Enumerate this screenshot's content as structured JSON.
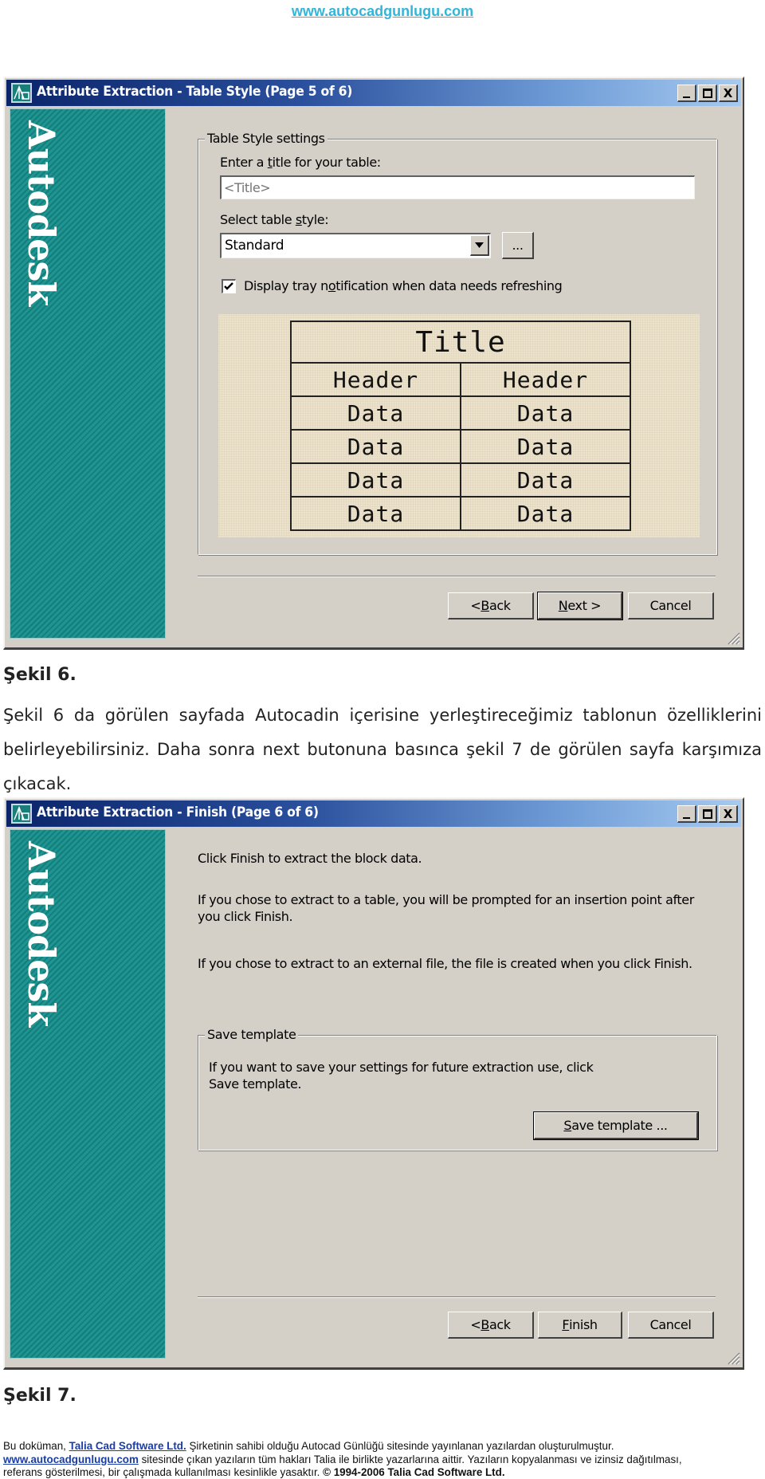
{
  "header": {
    "site_link": "www.autocadgunlugu.com"
  },
  "dialog1": {
    "title": "Attribute Extraction - Table Style (Page 5 of 6)",
    "brand": "Autodesk",
    "window_controls": {
      "minimize": "minimize-icon",
      "maximize": "maximize-icon",
      "close": "X"
    },
    "group_title": "Table Style settings",
    "title_label": {
      "pre": "Enter a ",
      "accel": "t",
      "post": "itle for your table:"
    },
    "title_input": {
      "value": "",
      "placeholder": "<Title>"
    },
    "style_label": {
      "pre": "Select table ",
      "accel": "s",
      "post": "tyle:"
    },
    "style_select": {
      "value": "Standard"
    },
    "browse_button": "...",
    "checkbox": {
      "checked": true,
      "label": {
        "pre": "Display tray n",
        "accel": "o",
        "post": "tification when data needs refreshing"
      }
    },
    "preview_table": {
      "title": "Title",
      "headers": [
        "Header",
        "Header"
      ],
      "rows": [
        [
          "Data",
          "Data"
        ],
        [
          "Data",
          "Data"
        ],
        [
          "Data",
          "Data"
        ],
        [
          "Data",
          "Data"
        ]
      ]
    },
    "buttons": {
      "back": {
        "pre": "< ",
        "accel": "B",
        "post": "ack"
      },
      "next": {
        "pre": "",
        "accel": "N",
        "post": "ext >"
      },
      "cancel": "Cancel"
    }
  },
  "caption1": "Şekil 6.",
  "paragraph": "Şekil 6 da görülen sayfada Autocadin içerisine yerleştireceğimiz tablonun özelliklerini belirleyebilirsiniz. Daha sonra next butonuna basınca şekil 7 de görülen sayfa karşımıza çıkacak.",
  "dialog2": {
    "title": "Attribute Extraction - Finish (Page 6 of 6)",
    "brand": "Autodesk",
    "window_controls": {
      "minimize": "minimize-icon",
      "maximize": "maximize-icon",
      "close": "X"
    },
    "messages": [
      "Click Finish to extract the block data.",
      "If you chose to extract to a table, you will be prompted for an insertion point after you click Finish.",
      "If you chose to extract to an external file, the file is created when you click Finish."
    ],
    "group_title": "Save template",
    "group_text": "If you want to save your settings for future extraction use, click Save template.",
    "save_template_button": {
      "pre": "",
      "accel": "S",
      "post": "ave template ..."
    },
    "buttons": {
      "back": {
        "pre": "< ",
        "accel": "B",
        "post": "ack"
      },
      "finish": {
        "pre": "",
        "accel": "F",
        "post": "inish"
      },
      "cancel": "Cancel"
    }
  },
  "caption2": "Şekil 7.",
  "footer": {
    "line1_pre": "Bu doküman, ",
    "line1_link": "Talia Cad Software Ltd.",
    "line1_post": " Şirketinin sahibi olduğu  Autocad Günlüğü sitesinde yayınlanan yazılardan oluşturulmuştur.",
    "line2_link": "www.autocadgunlugu.com",
    "line2_post": " sitesinde çıkan yazıların tüm hakları Talia ile birlikte yazarlarına aittir. Yazıların kopyalanması ve izinsiz dağıtılması,",
    "line3_pre": "referans gösterilmesi, bir çalışmada kullanılması kesinlikle yasaktır. ",
    "line3_bold": "© 1994-2006 Talia Cad Software Ltd."
  },
  "colors": {
    "link": "#33b5d9",
    "titlebar_start": "#0a246a",
    "titlebar_end": "#a6caf0",
    "sidebar_teal": "#138d8a",
    "dialog_face": "#d4d0c8",
    "preview_bg": "#ece2ca"
  }
}
